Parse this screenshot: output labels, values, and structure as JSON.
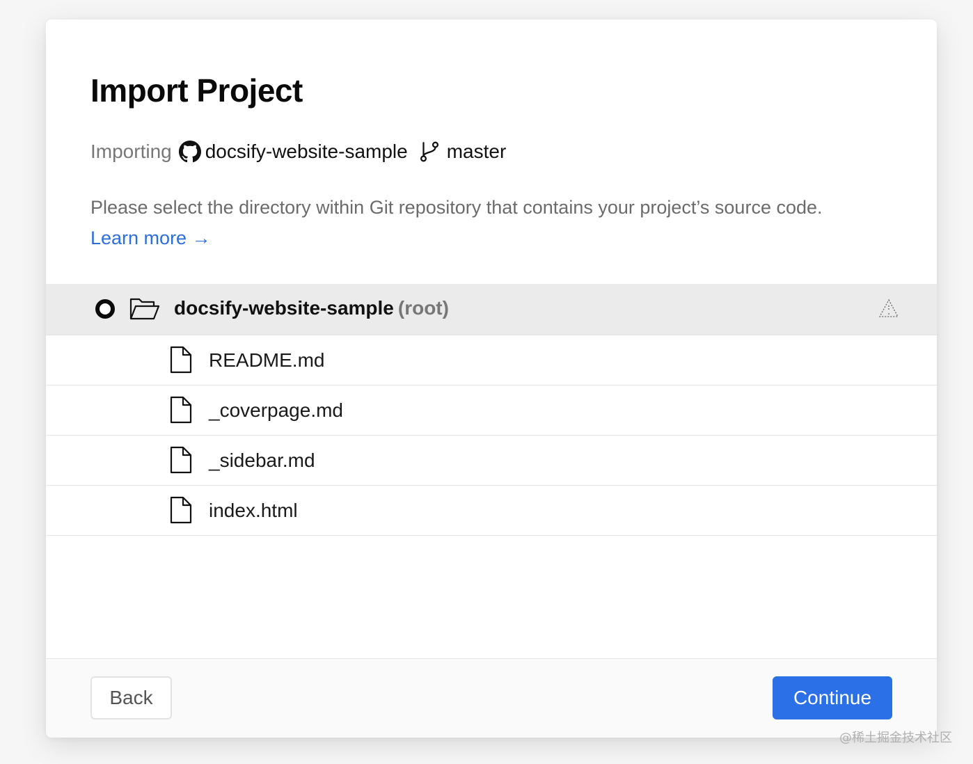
{
  "header": {
    "title": "Import Project",
    "importing_label": "Importing",
    "repo_name": "docsify-website-sample",
    "branch_name": "master"
  },
  "description": {
    "text": "Please select the directory within Git repository that contains your project’s source code.",
    "learn_more": "Learn more →"
  },
  "tree": {
    "root": {
      "name": "docsify-website-sample",
      "suffix": "(root)",
      "selected": true
    },
    "files": [
      {
        "name": "README.md"
      },
      {
        "name": "_coverpage.md"
      },
      {
        "name": "_sidebar.md"
      },
      {
        "name": "index.html"
      }
    ]
  },
  "footer": {
    "back_label": "Back",
    "continue_label": "Continue"
  },
  "watermark": "@稀土掘金技术社区",
  "colors": {
    "accent": "#2b70e6",
    "link": "#2d6fd8",
    "selected_row_bg": "#ebebeb"
  },
  "icons": {
    "repo": "github-icon",
    "branch": "git-branch-icon",
    "root_folder": "folder-open-icon",
    "file": "file-icon",
    "root_status": "warning-triangle-icon"
  }
}
